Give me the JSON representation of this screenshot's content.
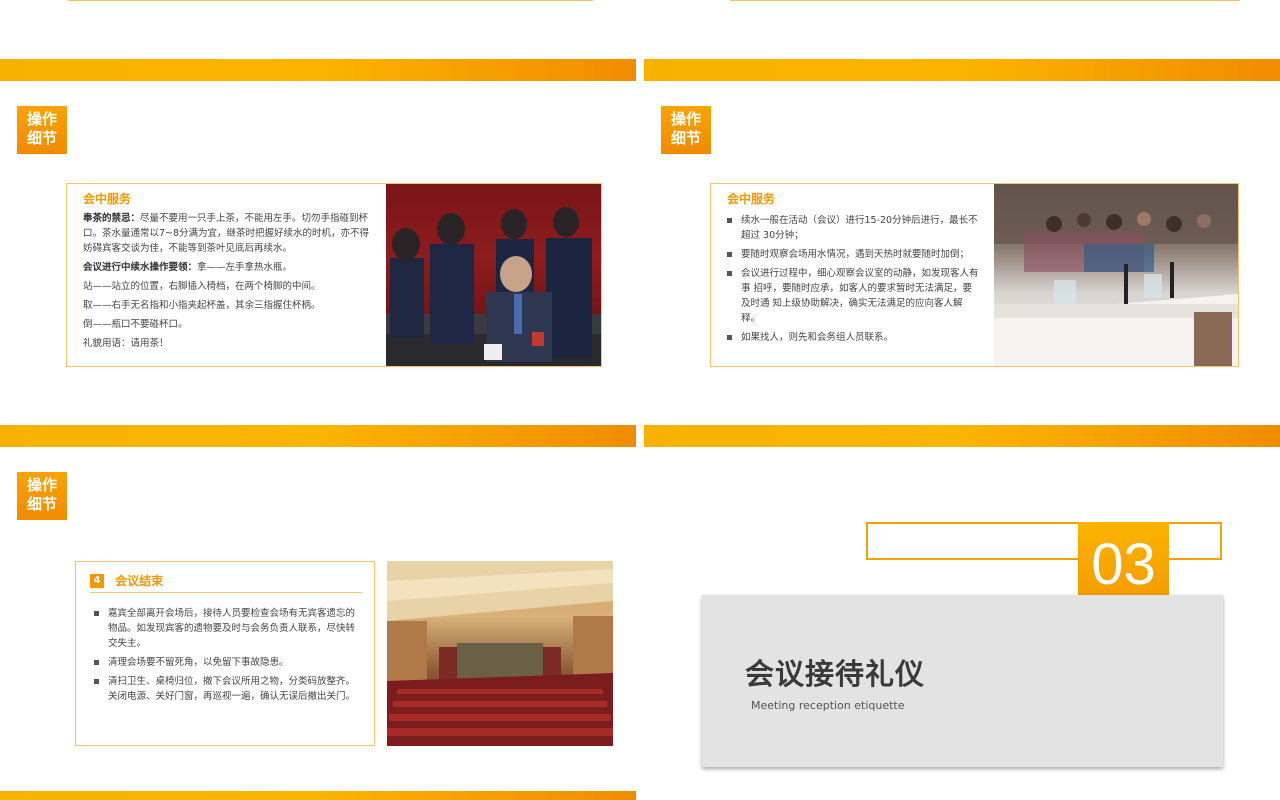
{
  "slide1": {
    "tag": "操作\n细节",
    "card_title": "会中服务",
    "p1_bold": "奉茶的禁忌：",
    "p1_text": "尽量不要用一只手上茶，不能用左手。切勿手指碰到杯口。茶水量通常以7~8分满为宜，继茶时把握好续水的时机，亦不得妨碍宾客交谈为佳，不能等到茶叶见底后再续水。",
    "p2_bold": "会议进行中续水操作要领：",
    "p2_text": "拿——左手拿热水瓶。",
    "lines": [
      "站——站立的位置，右脚插入椅档，在两个椅脚的中间。",
      "取——右手无名指和小指夹起杯盖，其余三指握住杯柄。",
      "倒——瓶口不要碰杯口。",
      "礼貌用语：请用茶！"
    ]
  },
  "slide2": {
    "tag": "操作\n细节",
    "card_title": "会中服务",
    "bullets": [
      "续水一般在活动（会议）进行15-20分钟后进行，最长不超过 30分钟；",
      "要随时观察会场用水情况，遇到天热时就要随时加倒；",
      "会议进行过程中，细心观察会议室的动静，如发现客人有事 招呼，要随时应承，如客人的要求暂时无法满足，要及时通 知上级协助解决，确实无法满足的应向客人解释。",
      "如果找人，则先和会务组人员联系。"
    ]
  },
  "slide3": {
    "tag": "操作\n细节",
    "step_number": "4",
    "card_title": "会议结束",
    "bullets": [
      "嘉宾全部离开会场后，接待人员要检查会场有无宾客遗忘的物品。如发现宾客的遗物要及时与会务负责人联系，尽快转交失主。",
      "清理会场要不留死角，以免留下事故隐患。",
      "清扫卫生、桌椅归位，撤下会议所用之物，分类码放整齐。关闭电源、关好门窗，再巡视一遍，确认无误后撤出关门。"
    ]
  },
  "slide4": {
    "section_number": "03",
    "title": "会议接待礼仪",
    "subtitle": "Meeting reception etiquette"
  }
}
